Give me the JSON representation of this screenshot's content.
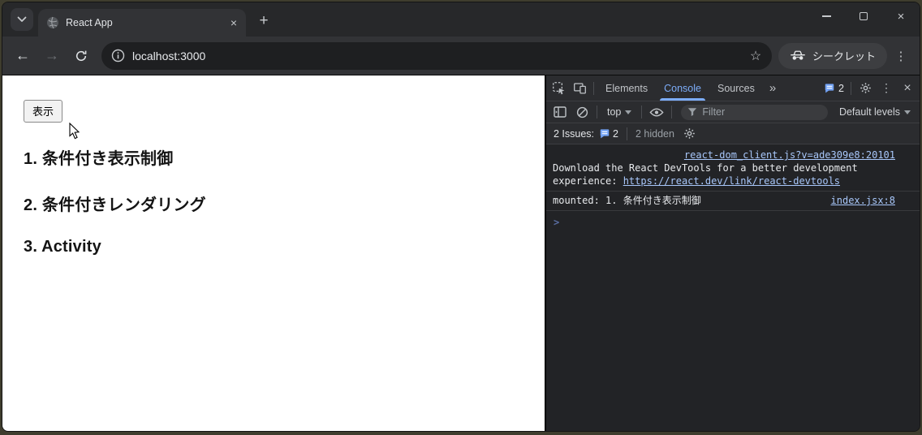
{
  "browser": {
    "tab_title": "React App",
    "url": "localhost:3000",
    "incognito_label": "シークレット"
  },
  "page": {
    "show_button": "表示",
    "headings": [
      "1. 条件付き表示制御",
      "2. 条件付きレンダリング",
      "3. Activity"
    ]
  },
  "devtools": {
    "panel_tabs": [
      "Elements",
      "Console",
      "Sources"
    ],
    "active_tab": "Console",
    "tab_issue_count": "2",
    "console_toolbar": {
      "context": "top",
      "filter_placeholder": "Filter",
      "levels_label": "Default levels"
    },
    "issues_bar": {
      "label": "2 Issues:",
      "count": "2",
      "hidden": "2 hidden"
    },
    "messages": [
      {
        "source": "react-dom_client.js?v=ade309e8:20101",
        "text": "Download the React DevTools for a better development experience: ",
        "link_text": "https://react.dev/link/react-devtools"
      },
      {
        "text": "mounted: 1. 条件付き表示制御",
        "source": "index.jsx:8"
      }
    ],
    "prompt_glyph": ">"
  },
  "icons": {
    "close": "×",
    "plus": "+",
    "back": "←",
    "forward": "→",
    "kebab": "⋮",
    "star": "☆",
    "more_tabs": "»"
  },
  "colors": {
    "devtools_accent": "#7cacf8",
    "console_link": "#a8c7fa",
    "issues_badge_blue": "#73a3f5",
    "page_background": "#ffffff",
    "chrome_frame": "#27282a",
    "chrome_toolbar": "#323336"
  }
}
